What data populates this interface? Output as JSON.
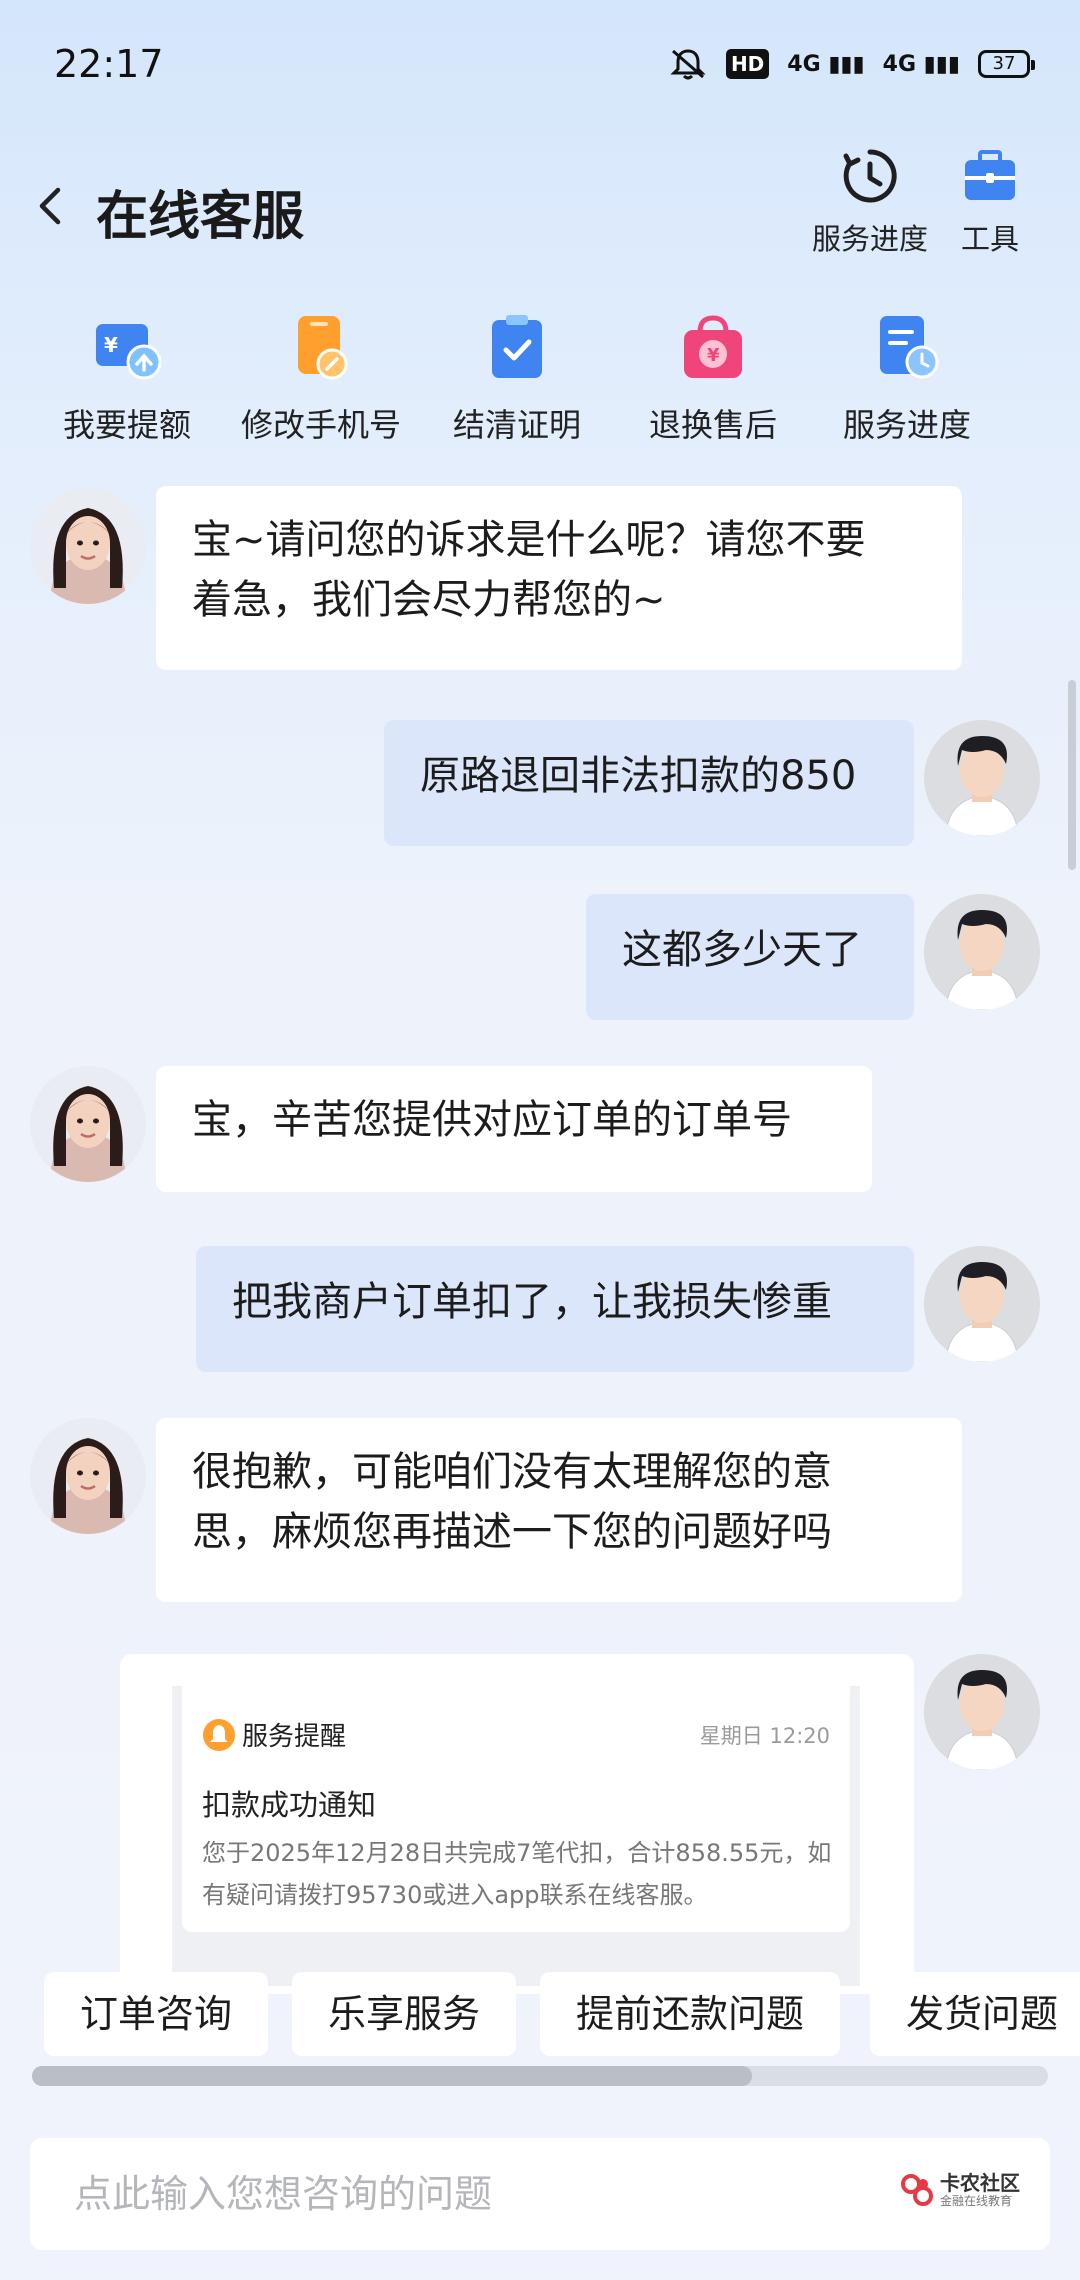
{
  "status_bar": {
    "time": "22:17",
    "signal_1": "4G",
    "signal_2": "4G",
    "hd": "HD",
    "battery": "37"
  },
  "header": {
    "title": "在线客服",
    "tools": [
      {
        "label": "服务进度",
        "icon": "clock-icon"
      },
      {
        "label": "工具",
        "icon": "toolbox-icon"
      }
    ]
  },
  "quick_actions": [
    {
      "label": "我要提额",
      "icon": "wallet-upload-icon"
    },
    {
      "label": "修改手机号",
      "icon": "phone-edit-icon"
    },
    {
      "label": "结清证明",
      "icon": "clipboard-check-icon"
    },
    {
      "label": "退换售后",
      "icon": "shopping-bag-yuan-icon"
    },
    {
      "label": "服务进度",
      "icon": "document-clock-icon"
    }
  ],
  "messages": [
    {
      "from": "agent",
      "text_1": "宝~请问您的诉求是什么呢？请您不要",
      "text_2": "着急，我们会尽力帮您的~"
    },
    {
      "from": "user",
      "text": "原路退回非法扣款的850"
    },
    {
      "from": "user",
      "text": "这都多少天了"
    },
    {
      "from": "agent",
      "text": "宝，辛苦您提供对应订单的订单号"
    },
    {
      "from": "user",
      "text": "把我商户订单扣了，让我损失惨重"
    },
    {
      "from": "agent",
      "text_1": "很抱歉，可能咱们没有太理解您的意",
      "text_2": "思，麻烦您再描述一下您的问题好吗"
    }
  ],
  "image_message": {
    "source": "服务提醒",
    "time": "星期日 12:20",
    "heading": "扣款成功通知",
    "body": "您于2025年12月28日共完成7笔代扣，合计858.55元，如有疑问请拨打95730或进入app联系在线客服。"
  },
  "suggestions": [
    "订单咨询",
    "乐享服务",
    "提前还款问题",
    "发货问题"
  ],
  "input": {
    "placeholder": "点此输入您想咨询的问题",
    "value": ""
  },
  "watermark": {
    "main": "卡农社区",
    "sub": "金融在线教育"
  },
  "colors": {
    "user_bubble": "#dce6fb",
    "agent_bubble": "#ffffff",
    "accent_blue": "#3f84f0",
    "accent_orange": "#ff9f2e",
    "accent_pink": "#f0457a"
  }
}
